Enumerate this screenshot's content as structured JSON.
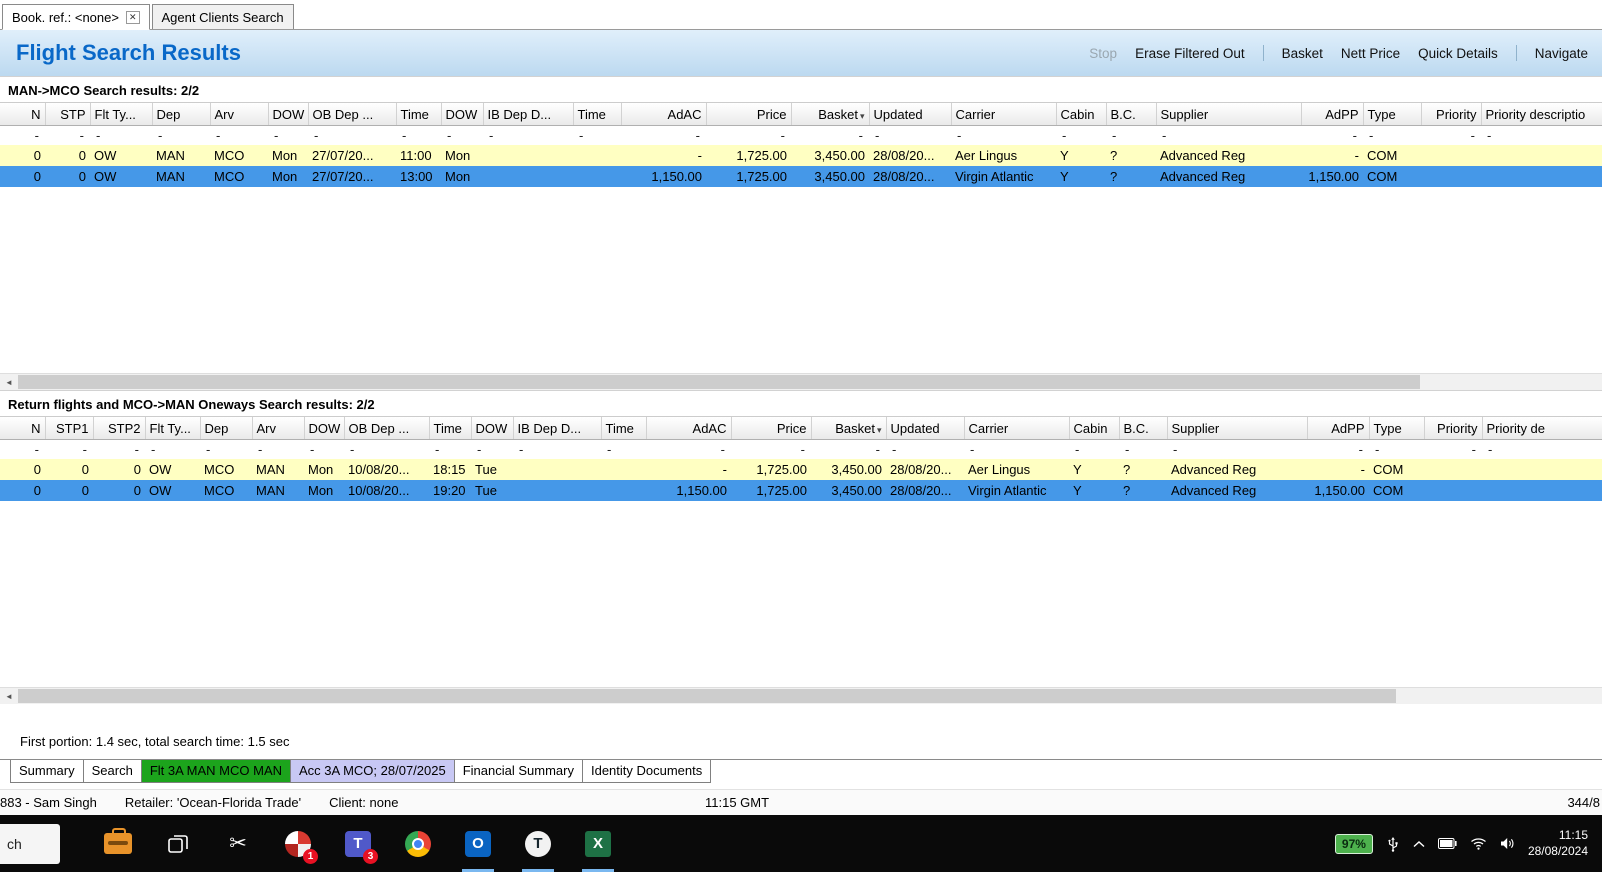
{
  "colors": {
    "title_blue": "#0968c8",
    "row_yellow": "#ffffc2",
    "row_selected_blue": "#4598e8",
    "tab_green": "#1ca41c",
    "tab_lavender": "#c8c8f4",
    "battery_green": "#4db14d"
  },
  "window_tabs": {
    "close_glyph": "✕",
    "tabs": [
      {
        "label": "Book. ref.: <none>",
        "closable": true,
        "active": true
      },
      {
        "label": "Agent Clients Search",
        "closable": false,
        "active": false
      }
    ]
  },
  "header": {
    "title": "Flight Search Results",
    "actions": [
      {
        "label": "Stop",
        "disabled": true
      },
      {
        "label": "Erase Filtered Out"
      },
      {
        "label": "Basket",
        "divider_before": true
      },
      {
        "label": "Nett Price"
      },
      {
        "label": "Quick Details"
      },
      {
        "label": "Navigate",
        "divider_before": true
      }
    ]
  },
  "scrollbar_left_glyph": "◄",
  "outbound_results": {
    "section_title": "MAN->MCO Search results: 2/2",
    "columns": [
      {
        "label": "N"
      },
      {
        "label": "STP"
      },
      {
        "label": "Flt Ty..."
      },
      {
        "label": "Dep"
      },
      {
        "label": "Arv"
      },
      {
        "label": "DOW"
      },
      {
        "label": "OB Dep ..."
      },
      {
        "label": "Time"
      },
      {
        "label": "DOW"
      },
      {
        "label": "IB Dep D..."
      },
      {
        "label": "Time"
      },
      {
        "label": "AdAC"
      },
      {
        "label": "Price"
      },
      {
        "label": "Basket",
        "sort": "▾"
      },
      {
        "label": "Updated"
      },
      {
        "label": "Carrier"
      },
      {
        "label": "Cabin"
      },
      {
        "label": "B.C."
      },
      {
        "label": "Supplier"
      },
      {
        "label": "AdPP"
      },
      {
        "label": "Type"
      },
      {
        "label": "Priority"
      },
      {
        "label": "Priority descriptio"
      }
    ],
    "filter_row": [
      "-",
      "-",
      "-",
      "-",
      "-",
      "-",
      "-",
      "-",
      "-",
      "-",
      "-",
      "-",
      "-",
      "-",
      "-",
      "-",
      "-",
      "-",
      "-",
      "-",
      "-",
      "-",
      "-"
    ],
    "rows": [
      {
        "highlight": "yellow",
        "cells": [
          "0",
          "0",
          "OW",
          "MAN",
          "MCO",
          "Mon",
          "27/07/20...",
          "11:00",
          "Mon",
          "",
          "",
          "-",
          "1,725.00",
          "3,450.00",
          "28/08/20...",
          "Aer Lingus",
          "Y",
          "?",
          "Advanced Reg",
          "-",
          "COM",
          "",
          ""
        ]
      },
      {
        "highlight": "blue",
        "cells": [
          "0",
          "0",
          "OW",
          "MAN",
          "MCO",
          "Mon",
          "27/07/20...",
          "13:00",
          "Mon",
          "",
          "",
          "1,150.00",
          "1,725.00",
          "3,450.00",
          "28/08/20...",
          "Virgin Atlantic",
          "Y",
          "?",
          "Advanced Reg",
          "1,150.00",
          "COM",
          "",
          ""
        ]
      }
    ]
  },
  "return_results": {
    "section_title": "Return flights and MCO->MAN Oneways Search results: 2/2",
    "columns": [
      {
        "label": "N"
      },
      {
        "label": "STP1"
      },
      {
        "label": "STP2"
      },
      {
        "label": "Flt Ty..."
      },
      {
        "label": "Dep"
      },
      {
        "label": "Arv"
      },
      {
        "label": "DOW"
      },
      {
        "label": "OB Dep ..."
      },
      {
        "label": "Time"
      },
      {
        "label": "DOW"
      },
      {
        "label": "IB Dep D..."
      },
      {
        "label": "Time"
      },
      {
        "label": "AdAC"
      },
      {
        "label": "Price"
      },
      {
        "label": "Basket",
        "sort": "▾"
      },
      {
        "label": "Updated"
      },
      {
        "label": "Carrier"
      },
      {
        "label": "Cabin"
      },
      {
        "label": "B.C."
      },
      {
        "label": "Supplier"
      },
      {
        "label": "AdPP"
      },
      {
        "label": "Type"
      },
      {
        "label": "Priority"
      },
      {
        "label": "Priority de"
      }
    ],
    "filter_row": [
      "-",
      "-",
      "-",
      "-",
      "-",
      "-",
      "-",
      "-",
      "-",
      "-",
      "-",
      "-",
      "-",
      "-",
      "-",
      "-",
      "-",
      "-",
      "-",
      "-",
      "-",
      "-",
      "-",
      "-"
    ],
    "rows": [
      {
        "highlight": "yellow",
        "cells": [
          "0",
          "0",
          "0",
          "OW",
          "MCO",
          "MAN",
          "Mon",
          "10/08/20...",
          "18:15",
          "Tue",
          "",
          "",
          "-",
          "1,725.00",
          "3,450.00",
          "28/08/20...",
          "Aer Lingus",
          "Y",
          "?",
          "Advanced Reg",
          "-",
          "COM",
          "",
          ""
        ]
      },
      {
        "highlight": "blue",
        "cells": [
          "0",
          "0",
          "0",
          "OW",
          "MCO",
          "MAN",
          "Mon",
          "10/08/20...",
          "19:20",
          "Tue",
          "",
          "",
          "1,150.00",
          "1,725.00",
          "3,450.00",
          "28/08/20...",
          "Virgin Atlantic",
          "Y",
          "?",
          "Advanced Reg",
          "1,150.00",
          "COM",
          "",
          ""
        ]
      }
    ]
  },
  "search_stats": "First portion: 1.4 sec, total search time: 1.5 sec",
  "bottom_tabs": [
    {
      "label": "Summary",
      "style": "plain"
    },
    {
      "label": "Search",
      "style": "plain"
    },
    {
      "label": "Flt 3A MAN MCO MAN",
      "style": "green"
    },
    {
      "label": "Acc 3A MCO; 28/07/2025",
      "style": "lavender"
    },
    {
      "label": "Financial Summary",
      "style": "plain"
    },
    {
      "label": "Identity Documents",
      "style": "plain"
    }
  ],
  "status_bar": {
    "agent": "883 - Sam Singh",
    "retailer": "Retailer: 'Ocean-Florida Trade'",
    "client": "Client: none",
    "time": "11:15 GMT",
    "counter": "344/8"
  },
  "taskbar": {
    "search_fragment": "ch",
    "icons": [
      {
        "name": "pinned-app-icon",
        "kind": "orange-case"
      },
      {
        "name": "task-view-icon",
        "kind": "task-view"
      },
      {
        "name": "snipping-tool-icon",
        "kind": "scissors",
        "glyph": "✂"
      },
      {
        "name": "browser-icon",
        "kind": "pinwheel",
        "badge": "1"
      },
      {
        "name": "teams-icon",
        "kind": "teams",
        "letter": "T",
        "badge": "3"
      },
      {
        "name": "chrome-icon",
        "kind": "chrome"
      },
      {
        "name": "outlook-icon",
        "kind": "outlook",
        "letter": "O",
        "active": true
      },
      {
        "name": "t-app-icon",
        "kind": "t-circle",
        "letter": "T",
        "active": true
      },
      {
        "name": "excel-icon",
        "kind": "excel",
        "letter": "X",
        "active": true
      }
    ],
    "tray": {
      "battery_percent": "97%",
      "time": "11:15",
      "date": "28/08/2024"
    }
  }
}
